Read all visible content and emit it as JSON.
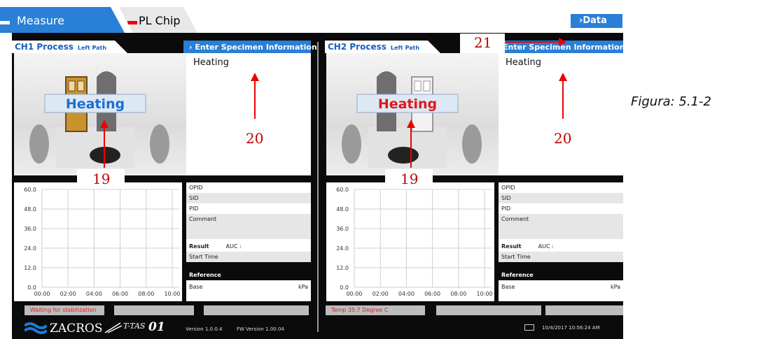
{
  "tabs": {
    "measure": "Measure",
    "pl_chip": "PL Chip"
  },
  "data_button": "Data",
  "ch1": {
    "process_title": "CH1 Process",
    "path": "Left Path",
    "enter_header": "Enter Specimen Information",
    "status": "Heating",
    "banner": "Heating",
    "info": {
      "opid": "OPID",
      "sid": "SID",
      "pid": "PID",
      "comment": "Comment",
      "result": "Result",
      "auc": "AUC :",
      "start_time": "Start Time",
      "reference": "Reference",
      "base": "Base",
      "kpa": "kPa"
    },
    "bottom_status": "Waiting for stabilization"
  },
  "ch2": {
    "process_title": "CH2 Process",
    "path": "Left Path",
    "enter_header": "Enter Specimen Information",
    "status": "Heating",
    "banner": "Heating",
    "info": {
      "opid": "OPID",
      "sid": "SID",
      "pid": "PID",
      "comment": "Comment",
      "result": "Result",
      "auc": "AUC :",
      "start_time": "Start Time",
      "reference": "Reference",
      "base": "Base",
      "kpa": "kPa"
    },
    "bottom_status": "Temp 35.7 Degree C"
  },
  "chart": {
    "y_ticks": [
      "60.0",
      "48.0",
      "36.0",
      "24.0",
      "12.0",
      "0.0"
    ],
    "x_ticks": [
      "00:00",
      "02:00",
      "04:00",
      "06:00",
      "08:00",
      "10:00"
    ]
  },
  "footer": {
    "brand": "ZACROS",
    "product": "T-TAS",
    "product_num": "01",
    "version": "Version 1.0.0.4",
    "fw_version": "FW Version 1.00.04",
    "datetime": "10/4/2017 10:56:24 AM"
  },
  "annotations": {
    "a19": "19",
    "a20": "20",
    "a21": "21",
    "figure": "Figura: 5.1-2"
  },
  "colors": {
    "accent": "#2a7fd6",
    "annot": "#c00000",
    "highlight_box": "#c8922e"
  }
}
